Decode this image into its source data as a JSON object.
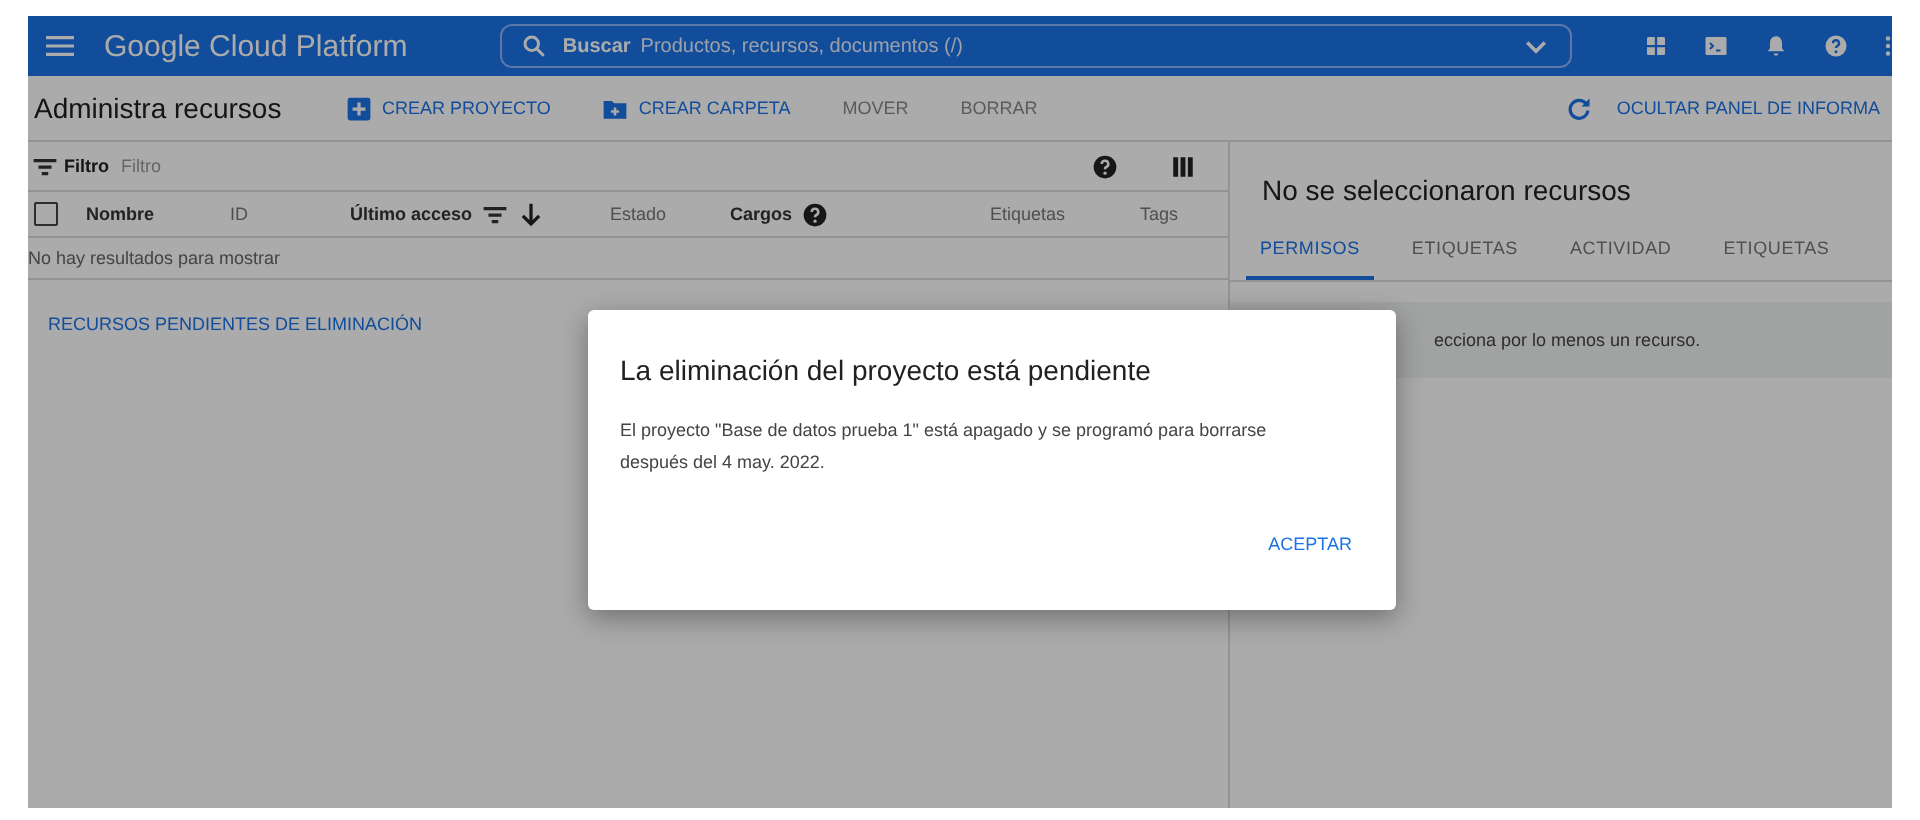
{
  "header": {
    "title": "Google Cloud Platform",
    "search": {
      "label": "Buscar",
      "placeholder": "Productos, recursos, documentos (/)"
    }
  },
  "toolbar": {
    "title": "Administra recursos",
    "actions": [
      {
        "label": "CREAR PROYECTO",
        "kind": "add",
        "disabled": false
      },
      {
        "label": "CREAR CARPETA",
        "kind": "folder",
        "disabled": false
      },
      {
        "label": "MOVER",
        "kind": "plain",
        "disabled": true
      },
      {
        "label": "BORRAR",
        "kind": "plain",
        "disabled": true
      }
    ],
    "panel_toggle": "OCULTAR PANEL DE INFORMA"
  },
  "filter": {
    "label": "Filtro",
    "placeholder": "Filtro"
  },
  "table": {
    "select_all": {
      "checked": false
    },
    "columns": [
      {
        "label": "Nombre",
        "strong": true,
        "kind": "plain"
      },
      {
        "label": "ID",
        "strong": false,
        "kind": "plain"
      },
      {
        "label": "Último acceso",
        "strong": true,
        "kind": "sorted"
      },
      {
        "label": "Estado",
        "strong": false,
        "kind": "plain"
      },
      {
        "label": "Cargos",
        "strong": true,
        "kind": "help"
      },
      {
        "label": "Etiquetas",
        "strong": false,
        "kind": "plain"
      },
      {
        "label": "Tags",
        "strong": false,
        "kind": "plain"
      }
    ],
    "empty_message": "No hay resultados para mostrar"
  },
  "pending_link": "RECURSOS PENDIENTES DE ELIMINACIÓN",
  "info_panel": {
    "title": "No se seleccionaron recursos",
    "tabs": [
      {
        "label": "PERMISOS",
        "selected": true
      },
      {
        "label": "ETIQUETAS",
        "selected": false
      },
      {
        "label": "ACTIVIDAD",
        "selected": false
      },
      {
        "label": "ETIQUETAS",
        "selected": false
      }
    ],
    "message": "ecciona por lo menos un recurso."
  },
  "dialog": {
    "title": "La eliminación del proyecto está pendiente",
    "body": "El proyecto \"Base de datos prueba 1\" está apagado y se programó para borrarse después del 4 may. 2022.",
    "button": "ACEPTAR"
  }
}
